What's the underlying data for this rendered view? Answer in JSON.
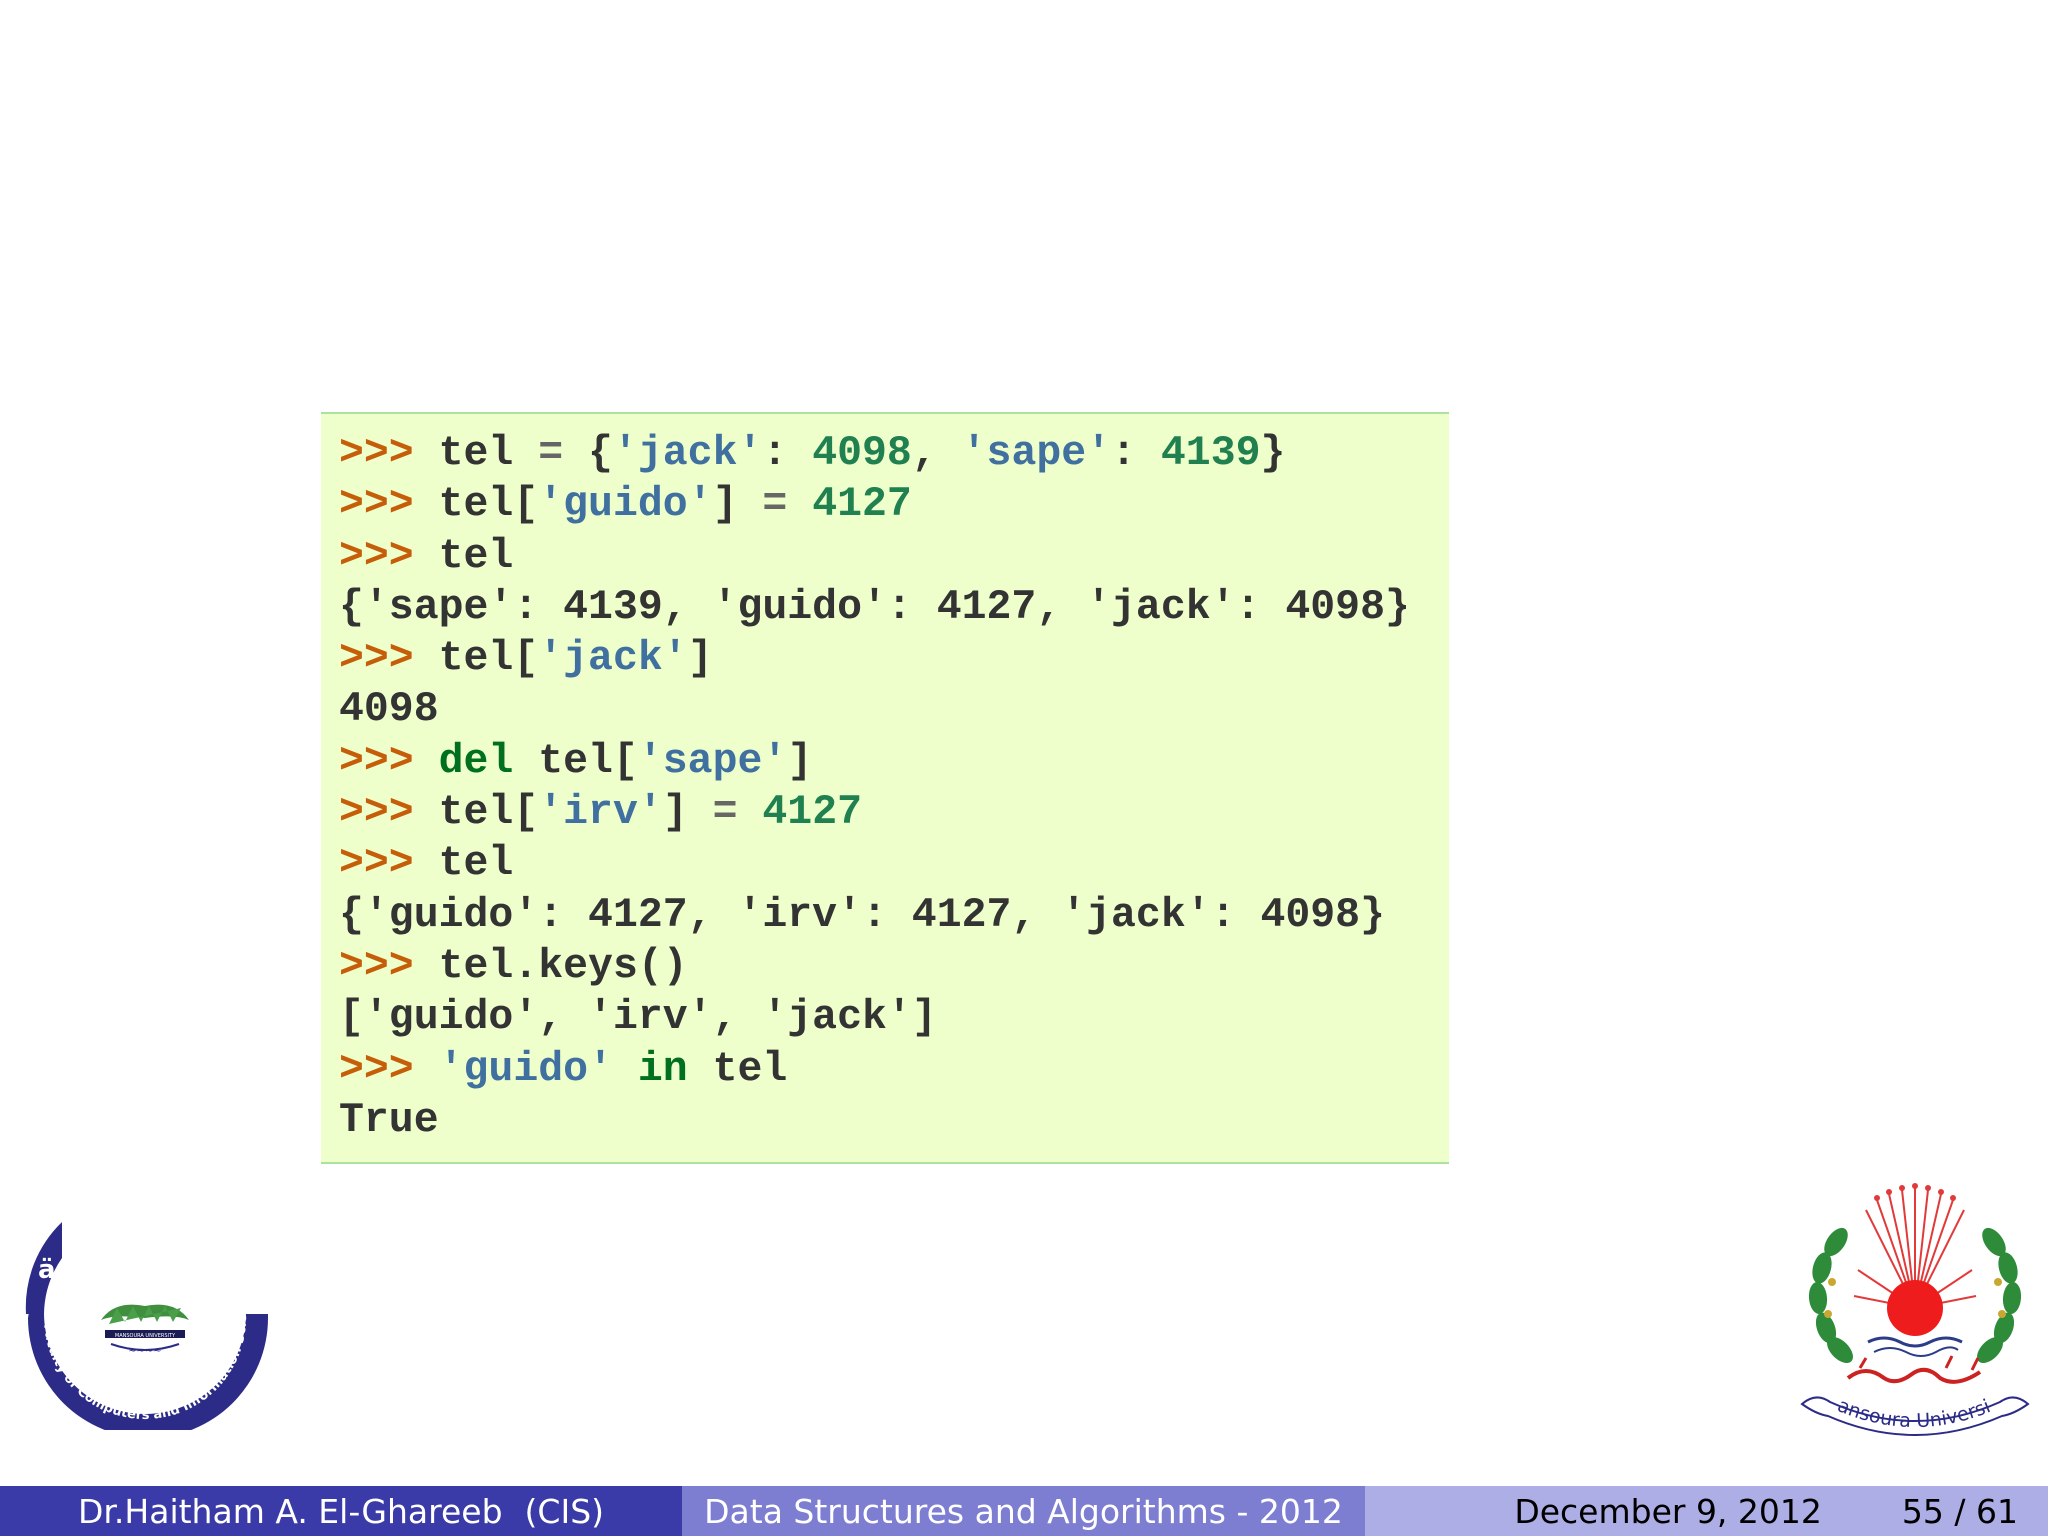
{
  "code": {
    "lines": [
      [
        {
          "t": "gp",
          "v": ">>>"
        },
        {
          "t": "",
          "v": " tel "
        },
        {
          "t": "o",
          "v": "="
        },
        {
          "t": "",
          "v": " {"
        },
        {
          "t": "s",
          "v": "'jack'"
        },
        {
          "t": "",
          "v": ": "
        },
        {
          "t": "m",
          "v": "4098"
        },
        {
          "t": "",
          "v": ", "
        },
        {
          "t": "s",
          "v": "'sape'"
        },
        {
          "t": "",
          "v": ": "
        },
        {
          "t": "m",
          "v": "4139"
        },
        {
          "t": "",
          "v": "}"
        }
      ],
      [
        {
          "t": "gp",
          "v": ">>>"
        },
        {
          "t": "",
          "v": " tel["
        },
        {
          "t": "s",
          "v": "'guido'"
        },
        {
          "t": "",
          "v": "] "
        },
        {
          "t": "o",
          "v": "="
        },
        {
          "t": "",
          "v": " "
        },
        {
          "t": "m",
          "v": "4127"
        }
      ],
      [
        {
          "t": "gp",
          "v": ">>>"
        },
        {
          "t": "",
          "v": " tel"
        }
      ],
      [
        {
          "t": "",
          "v": "{'sape': 4139, 'guido': 4127, 'jack': 4098}"
        }
      ],
      [
        {
          "t": "gp",
          "v": ">>>"
        },
        {
          "t": "",
          "v": " tel["
        },
        {
          "t": "s",
          "v": "'jack'"
        },
        {
          "t": "",
          "v": "]"
        }
      ],
      [
        {
          "t": "",
          "v": "4098"
        }
      ],
      [
        {
          "t": "gp",
          "v": ">>>"
        },
        {
          "t": "",
          "v": " "
        },
        {
          "t": "k",
          "v": "del"
        },
        {
          "t": "",
          "v": " tel["
        },
        {
          "t": "s",
          "v": "'sape'"
        },
        {
          "t": "",
          "v": "]"
        }
      ],
      [
        {
          "t": "gp",
          "v": ">>>"
        },
        {
          "t": "",
          "v": " tel["
        },
        {
          "t": "s",
          "v": "'irv'"
        },
        {
          "t": "",
          "v": "] "
        },
        {
          "t": "o",
          "v": "="
        },
        {
          "t": "",
          "v": " "
        },
        {
          "t": "m",
          "v": "4127"
        }
      ],
      [
        {
          "t": "gp",
          "v": ">>>"
        },
        {
          "t": "",
          "v": " tel"
        }
      ],
      [
        {
          "t": "",
          "v": "{'guido': 4127, 'irv': 4127, 'jack': 4098}"
        }
      ],
      [
        {
          "t": "gp",
          "v": ">>>"
        },
        {
          "t": "",
          "v": " tel.keys()"
        }
      ],
      [
        {
          "t": "",
          "v": "['guido', 'irv', 'jack']"
        }
      ],
      [
        {
          "t": "gp",
          "v": ">>>"
        },
        {
          "t": "",
          "v": " "
        },
        {
          "t": "s",
          "v": "'guido'"
        },
        {
          "t": "",
          "v": " "
        },
        {
          "t": "k",
          "v": "in"
        },
        {
          "t": "",
          "v": " tel"
        }
      ],
      [
        {
          "t": "",
          "v": "True"
        }
      ]
    ],
    "colors": {
      "background": "#eeffcc",
      "prompt": "#c65d09",
      "string": "#4070a0",
      "number": "#208050",
      "keyword": "#007020"
    }
  },
  "logos": {
    "left": {
      "icon": "faculty-of-computers-and-information-seal",
      "text": "Faculty of Computers and Information Science"
    },
    "right": {
      "icon": "mansoura-university-seal",
      "text": "Mansoura University"
    }
  },
  "footer": {
    "author": "Dr.Haitham A. El-Ghareeb",
    "affiliation": "(CIS)",
    "title": "Data Structures and Algorithms - 2012",
    "date": "December 9, 2012",
    "page": "55 / 61",
    "colors": {
      "left": "#3a3aa8",
      "middle": "#7d7dd2",
      "right": "#aeaee6"
    }
  }
}
